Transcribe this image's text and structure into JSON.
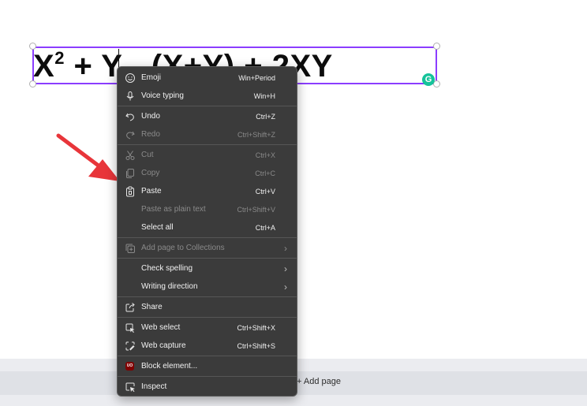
{
  "editor": {
    "equation_a": "X",
    "equation_exp": "2",
    "equation_b": " + Y - (X+Y)  + 2XY",
    "grammarly_letter": "G",
    "add_page_label": "+ Add page"
  },
  "context_menu": {
    "emoji": {
      "label": "Emoji",
      "shortcut": "Win+Period"
    },
    "voice_typing": {
      "label": "Voice typing",
      "shortcut": "Win+H"
    },
    "undo": {
      "label": "Undo",
      "shortcut": "Ctrl+Z"
    },
    "redo": {
      "label": "Redo",
      "shortcut": "Ctrl+Shift+Z"
    },
    "cut": {
      "label": "Cut",
      "shortcut": "Ctrl+X"
    },
    "copy": {
      "label": "Copy",
      "shortcut": "Ctrl+C"
    },
    "paste": {
      "label": "Paste",
      "shortcut": "Ctrl+V"
    },
    "paste_plain": {
      "label": "Paste as plain text",
      "shortcut": "Ctrl+Shift+V"
    },
    "select_all": {
      "label": "Select all",
      "shortcut": "Ctrl+A"
    },
    "add_collections": {
      "label": "Add page to Collections"
    },
    "check_spelling": {
      "label": "Check spelling"
    },
    "writing_direction": {
      "label": "Writing direction"
    },
    "share": {
      "label": "Share"
    },
    "web_select": {
      "label": "Web select",
      "shortcut": "Ctrl+Shift+X"
    },
    "web_capture": {
      "label": "Web capture",
      "shortcut": "Ctrl+Shift+S"
    },
    "block_element": {
      "label": "Block element..."
    },
    "inspect": {
      "label": "Inspect"
    },
    "ublock_badge": "UO",
    "submenu_glyph": "›"
  },
  "colors": {
    "selection": "#8b3dff",
    "menu_bg": "#3b3b3b",
    "arrow": "#e8353a",
    "grammarly": "#15c39a"
  }
}
